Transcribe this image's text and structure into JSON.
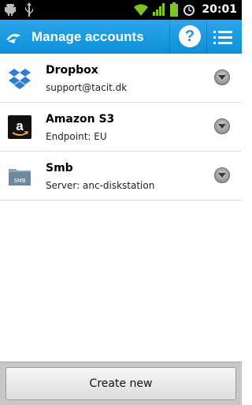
{
  "status_bar": {
    "time": "20:01",
    "icons": [
      "android-debug-icon",
      "usb-icon",
      "wifi-icon",
      "signal-icon",
      "battery-icon",
      "alarm-icon"
    ]
  },
  "action_bar": {
    "title": "Manage accounts",
    "help_label": "?",
    "icons": [
      "app-logo-icon",
      "help-icon",
      "list-menu-icon"
    ],
    "color": "#1a95dd"
  },
  "accounts": [
    {
      "title": "Dropbox",
      "subtitle": "support@tacit.dk",
      "icon": "dropbox-icon"
    },
    {
      "title": "Amazon S3",
      "subtitle": "Endpoint: EU",
      "icon": "amazon-icon"
    },
    {
      "title": "Smb",
      "subtitle": "Server: anc-diskstation",
      "icon": "smb-folder-icon"
    }
  ],
  "bottom": {
    "create_label": "Create new"
  }
}
